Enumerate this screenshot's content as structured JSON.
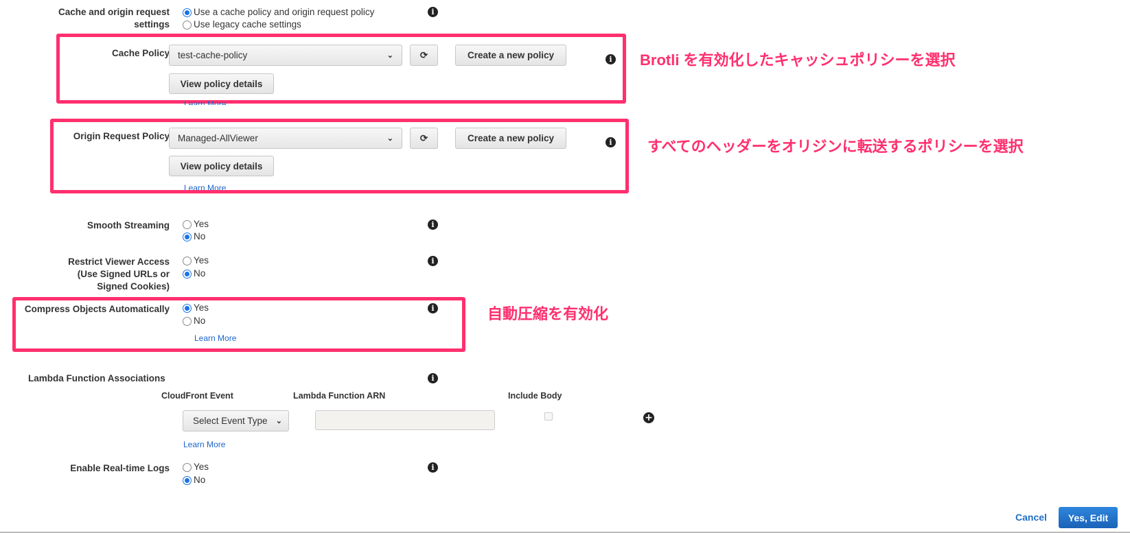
{
  "cache_origin": {
    "label_line1": "Cache and origin request",
    "label_line2": "settings",
    "options": [
      "Use a cache policy and origin request policy",
      "Use legacy cache settings"
    ],
    "selected": 0
  },
  "cache_policy": {
    "label": "Cache Policy",
    "value": "test-cache-policy",
    "create": "Create a new policy",
    "view": "View policy details",
    "learn_more": "Learn More"
  },
  "origin_policy": {
    "label": "Origin Request Policy",
    "value": "Managed-AllViewer",
    "create": "Create a new policy",
    "view": "View policy details",
    "learn_more": "Learn More"
  },
  "smooth": {
    "label": "Smooth Streaming",
    "yes": "Yes",
    "no": "No",
    "selected": "No"
  },
  "restrict": {
    "label_line1": "Restrict Viewer Access",
    "label_line2": "(Use Signed URLs or",
    "label_line3": "Signed Cookies)",
    "yes": "Yes",
    "no": "No",
    "selected": "No"
  },
  "compress": {
    "label": "Compress Objects Automatically",
    "yes": "Yes",
    "no": "No",
    "selected": "Yes",
    "learn_more": "Learn More"
  },
  "lambda": {
    "label": "Lambda Function Associations",
    "col_event": "CloudFront Event",
    "col_arn": "Lambda Function ARN",
    "col_body": "Include Body",
    "event_select": "Select Event Type",
    "arn_value": "",
    "learn_more": "Learn More"
  },
  "realtime": {
    "label": "Enable Real-time Logs",
    "yes": "Yes",
    "no": "No",
    "selected": "No"
  },
  "footer": {
    "cancel": "Cancel",
    "submit": "Yes, Edit"
  },
  "annotations": {
    "a1": "Brotli を有効化したキャッシュポリシーを選択",
    "a2": "すべてのヘッダーをオリジンに転送するポリシーを選択",
    "a3": "自動圧縮を有効化"
  },
  "colors": {
    "accent": "#1a73e8",
    "annotation": "#ff2f6e",
    "primary_button": "#1f6fc5"
  }
}
